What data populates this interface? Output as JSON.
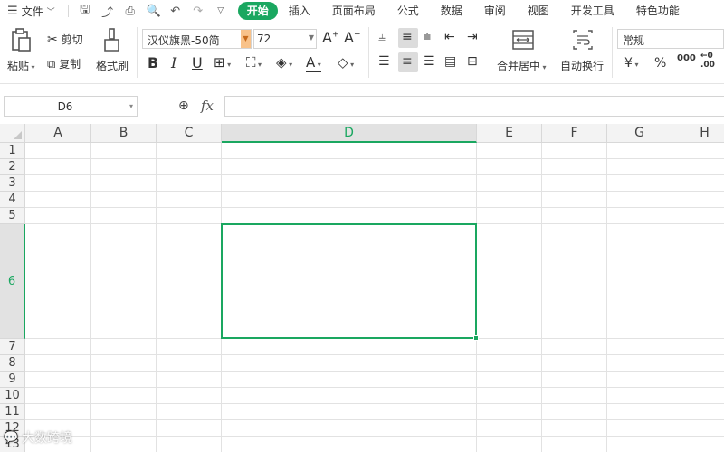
{
  "menubar": {
    "file_label": "文件",
    "tabs": [
      "开始",
      "插入",
      "页面布局",
      "公式",
      "数据",
      "审阅",
      "视图",
      "开发工具",
      "特色功能"
    ]
  },
  "ribbon": {
    "paste": "粘贴",
    "cut": "剪切",
    "copy": "复制",
    "format_painter": "格式刷",
    "font_name": "汉仪旗黑-50简",
    "font_size": "72",
    "merge_center": "合并居中",
    "wrap_text": "自动换行",
    "number_format": "常规",
    "currency_symbol": "¥",
    "percent_symbol": "%",
    "thousands_symbol": "000",
    "decimal_symbol": "←0 .00"
  },
  "formula_bar": {
    "name_box": "D6",
    "fx": "fx",
    "formula": ""
  },
  "grid": {
    "columns": [
      "A",
      "B",
      "C",
      "D",
      "E",
      "F",
      "G",
      "H"
    ],
    "rows": [
      "1",
      "2",
      "3",
      "4",
      "5",
      "6",
      "7",
      "8",
      "9",
      "10",
      "11",
      "12",
      "13"
    ],
    "selected_cell": "D6"
  },
  "watermark": "大数跨境",
  "colors": {
    "accent": "#1aa760",
    "header_bg": "#f3f3f3",
    "selected_header_bg": "#e2e2e2",
    "gridline": "#e2e2e2"
  }
}
